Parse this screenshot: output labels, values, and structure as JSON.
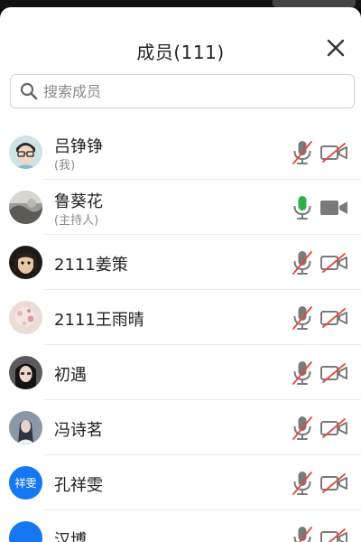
{
  "header": {
    "title": "成员(111)"
  },
  "search": {
    "placeholder": "搜索成员"
  },
  "colors": {
    "muted_slash": "#e24a3b",
    "active_mic": "#2fb14a",
    "icon_gray": "#7a7a7a",
    "avatar_blue": "#1677f2"
  },
  "members": [
    {
      "name": "吕铮铮",
      "sub": "(我)",
      "mic": "muted",
      "camera": "off",
      "avatar": "cartoon-glasses"
    },
    {
      "name": "鲁葵花",
      "sub": "(主持人)",
      "mic": "on",
      "camera": "on",
      "avatar": "photo-gray"
    },
    {
      "name": "2111姜策",
      "sub": "",
      "mic": "muted",
      "camera": "off",
      "avatar": "photo-dark"
    },
    {
      "name": "2111王雨晴",
      "sub": "",
      "mic": "muted",
      "camera": "off",
      "avatar": "photo-pink"
    },
    {
      "name": "初遇",
      "sub": "",
      "mic": "muted",
      "camera": "off",
      "avatar": "photo-girl"
    },
    {
      "name": "冯诗茗",
      "sub": "",
      "mic": "muted",
      "camera": "off",
      "avatar": "photo-bluegray"
    },
    {
      "name": "孔祥雯",
      "sub": "",
      "mic": "muted",
      "camera": "off",
      "avatar": "text",
      "avatar_text": "祥雯"
    },
    {
      "name": "汉博",
      "sub": "",
      "mic": "muted",
      "camera": "off",
      "avatar": "text",
      "avatar_text": ""
    }
  ]
}
